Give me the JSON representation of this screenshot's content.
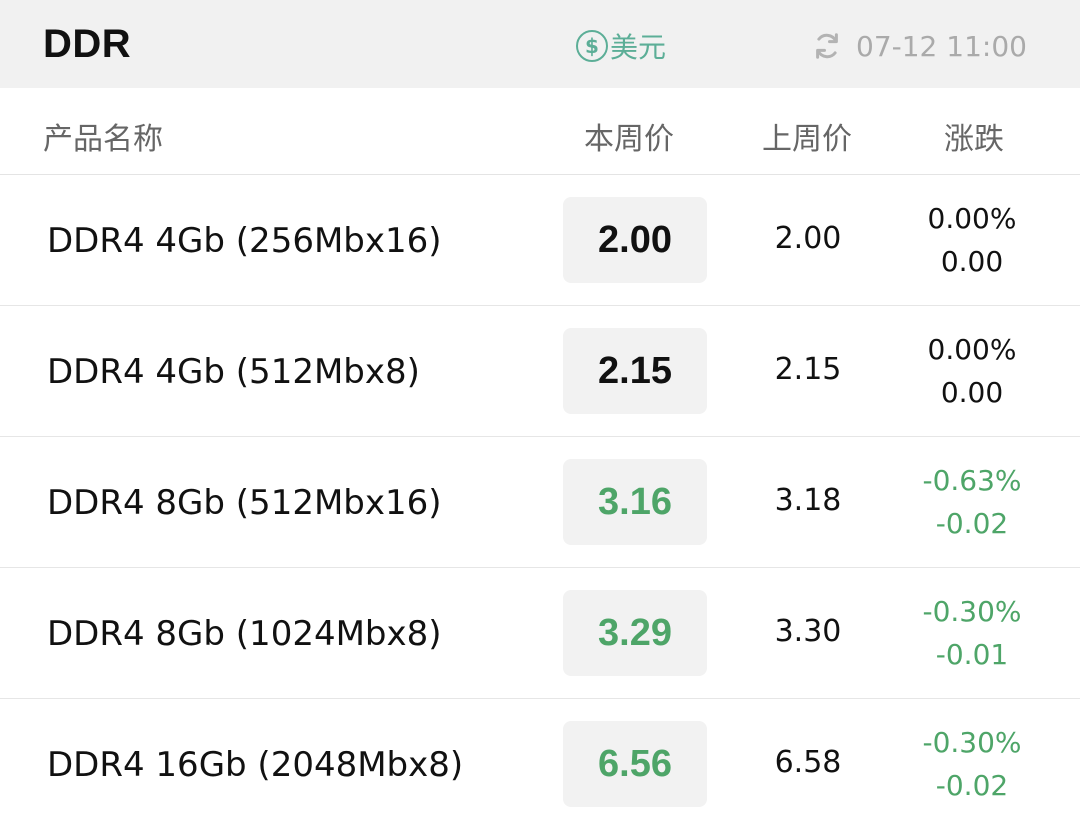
{
  "header": {
    "title": "DDR",
    "currency_label": "美元",
    "currency_icon": "dollar-circle-icon",
    "refresh_icon": "refresh-icon",
    "updated_time": "07-12 11:00"
  },
  "columns": {
    "name": "产品名称",
    "this_week": "本周价",
    "last_week": "上周价",
    "change": "涨跌"
  },
  "colors": {
    "accent": "#5cae97",
    "down": "#4ea568",
    "flat": "#111111",
    "price_box_bg": "#f2f2f2"
  },
  "rows": [
    {
      "name": "DDR4 4Gb (256Mbx16)",
      "this_week": "2.00",
      "last_week": "2.00",
      "change_pct": "0.00%",
      "change_abs": "0.00",
      "trend": "flat"
    },
    {
      "name": "DDR4 4Gb (512Mbx8)",
      "this_week": "2.15",
      "last_week": "2.15",
      "change_pct": "0.00%",
      "change_abs": "0.00",
      "trend": "flat"
    },
    {
      "name": "DDR4 8Gb (512Mbx16)",
      "this_week": "3.16",
      "last_week": "3.18",
      "change_pct": "-0.63%",
      "change_abs": "-0.02",
      "trend": "down"
    },
    {
      "name": "DDR4 8Gb (1024Mbx8)",
      "this_week": "3.29",
      "last_week": "3.30",
      "change_pct": "-0.30%",
      "change_abs": "-0.01",
      "trend": "down"
    },
    {
      "name": "DDR4 16Gb (2048Mbx8)",
      "this_week": "6.56",
      "last_week": "6.58",
      "change_pct": "-0.30%",
      "change_abs": "-0.02",
      "trend": "down"
    }
  ]
}
